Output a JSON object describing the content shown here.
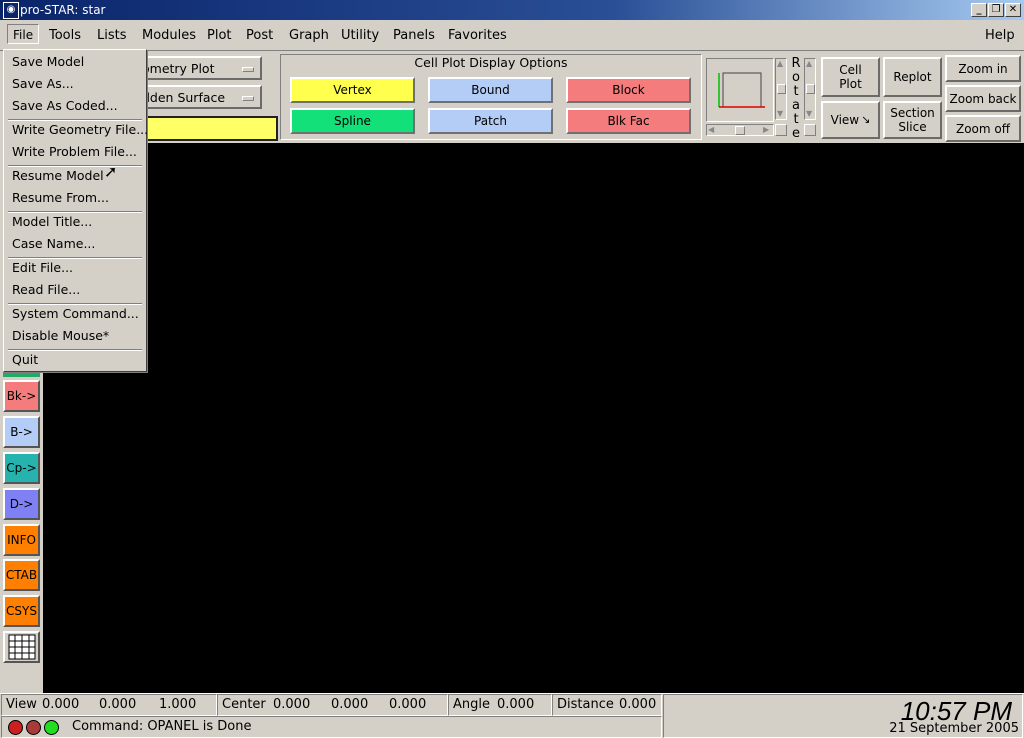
{
  "window": {
    "title": "pro-STAR: star",
    "app_icon": "globe-icon",
    "controls": [
      "minimize",
      "restore",
      "close"
    ]
  },
  "menubar": {
    "items": [
      {
        "label": "File",
        "mnemonic": "F"
      },
      {
        "label": "Tools",
        "mnemonic": "T"
      },
      {
        "label": "Lists",
        "mnemonic": "L"
      },
      {
        "label": "Modules",
        "mnemonic": "M"
      },
      {
        "label": "Plot",
        "mnemonic": "P"
      },
      {
        "label": "Post",
        "mnemonic": "P"
      },
      {
        "label": "Graph",
        "mnemonic": "G"
      },
      {
        "label": "Utility",
        "mnemonic": "U"
      },
      {
        "label": "Panels",
        "mnemonic": "a"
      },
      {
        "label": "Favorites",
        "mnemonic": "v"
      }
    ],
    "help": "Help"
  },
  "file_menu": {
    "groups": [
      [
        "Save Model",
        "Save As...",
        "Save As Coded..."
      ],
      [
        "Write Geometry File...",
        "Write Problem File..."
      ],
      [
        "Resume Model",
        "Resume From..."
      ],
      [
        "Model Title...",
        "Case Name..."
      ],
      [
        "Edit File...",
        "Read File..."
      ],
      [
        "System Command...",
        "Disable Mouse*"
      ],
      [
        "Quit"
      ]
    ]
  },
  "toolbar": {
    "plot_type_select": "ometry Plot",
    "surface_select": "dden Surface",
    "command_field_value": "",
    "command_field_color": "#ffff66"
  },
  "cell_plot": {
    "heading": "Cell Plot Display Options",
    "buttons": [
      {
        "label": "Vertex",
        "color": "#ffff4d"
      },
      {
        "label": "Bound",
        "color": "#b3cdf7"
      },
      {
        "label": "Block",
        "color": "#f47c7c"
      },
      {
        "label": "Spline",
        "color": "#14e07a"
      },
      {
        "label": "Patch",
        "color": "#b3cdf7"
      },
      {
        "label": "Blk Fac",
        "color": "#f47c7c"
      }
    ]
  },
  "view_controls": {
    "rotate_label": [
      "R",
      "o",
      "t",
      "a",
      "t",
      "e"
    ],
    "cell_plot": [
      "Cell",
      "Plot"
    ],
    "replot": "Replot",
    "view": "View",
    "section_slice": [
      "Section",
      "Slice"
    ],
    "zoom_in": "Zoom in",
    "zoom_back": "Zoom back",
    "zoom_off": "Zoom off"
  },
  "palette": [
    {
      "label": "Bk->",
      "color": "#f47c7c"
    },
    {
      "label": "B->",
      "color": "#b3cdf7"
    },
    {
      "label": "Cp->",
      "color": "#26b3ad"
    },
    {
      "label": "D->",
      "color": "#8080f5"
    },
    {
      "label": "INFO",
      "color": "#ff8000"
    },
    {
      "label": "CTAB",
      "color": "#ff8000"
    },
    {
      "label": "CSYS",
      "color": "#ff8000"
    },
    {
      "label": "table-grid-icon",
      "color": "#d4d0c8"
    }
  ],
  "status": {
    "view_label": "View",
    "view_values": [
      "0.000",
      "0.000",
      "1.000"
    ],
    "center_label": "Center",
    "center_values": [
      "0.000",
      "0.000",
      "0.000"
    ],
    "angle_label": "Angle",
    "angle_value": "0.000",
    "distance_label": "Distance",
    "distance_value": "0.000",
    "command_text": "Command: OPANEL is Done",
    "lights": [
      "#cc1f1f",
      "#a83a3a",
      "#22dd22"
    ],
    "time": "10:57 PM",
    "date": "21 September 2005"
  }
}
